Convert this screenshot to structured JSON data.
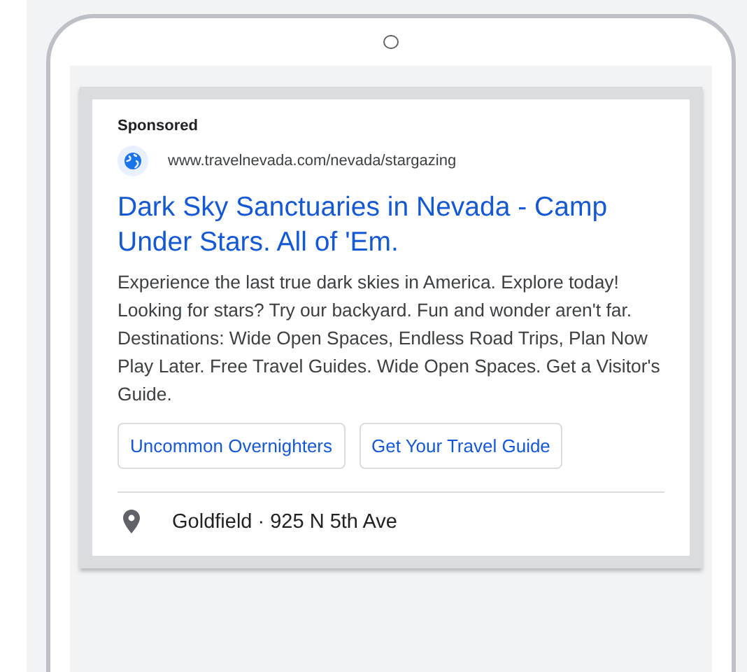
{
  "ad": {
    "label": "Sponsored",
    "url": "www.travelnevada.com/nevada/stargazing",
    "headline": "Dark Sky Sanctuaries in Nevada - Camp Under Stars. All of 'Em.",
    "description": "Experience the last true dark skies in America. Explore today! Looking for stars? Try our backyard. Fun and wonder aren't far. Destinations: Wide Open Spaces, Endless Road Trips, Plan Now Play Later. Free Travel Guides. Wide Open Spaces. Get a Visitor's Guide.",
    "sitelinks": [
      "Uncommon Overnighters",
      "Get Your Travel Guide"
    ],
    "location": "Goldfield · 925 N 5th Ave"
  }
}
